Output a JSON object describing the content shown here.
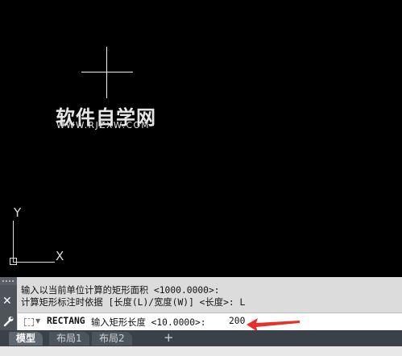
{
  "watermark": {
    "title": "软件自学网",
    "url": "WWW.RJZXW.COM"
  },
  "ucs": {
    "y_label": "Y",
    "x_label": "X"
  },
  "command": {
    "history": [
      "输入以当前单位计算的矩形面积 <1000.0000>:",
      "计算矩形标注时依据 [长度(L)/宽度(W)] <长度>: L"
    ],
    "name": "RECTANG",
    "prompt": "输入矩形长度 <10.0000>:",
    "value": "200"
  },
  "tabs": [
    {
      "label": "模型",
      "active": true
    },
    {
      "label": "布局1",
      "active": false
    },
    {
      "label": "布局2",
      "active": false
    }
  ],
  "tab_add": "+",
  "colors": {
    "canvas": "#000000",
    "arrow": "#e8312a"
  },
  "icons": [
    "crosshair-icon",
    "close-icon",
    "wrench-icon",
    "command-icon",
    "chevron-down-icon",
    "plus-icon"
  ]
}
